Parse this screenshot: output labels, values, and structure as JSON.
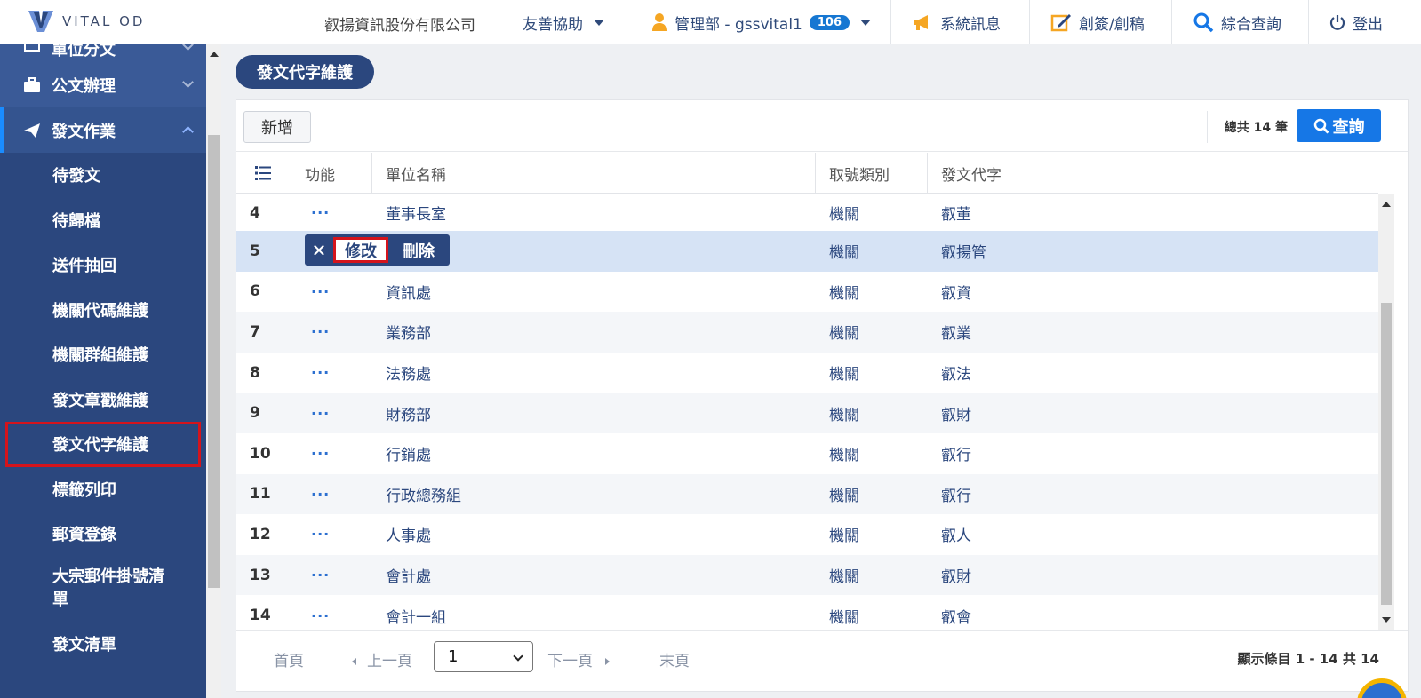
{
  "header": {
    "brand": "VITAL OD",
    "company": "叡揚資訊股份有限公司",
    "nav": {
      "help": "友善協助",
      "user": "管理部 - gssvital1",
      "user_badge": "106",
      "messages": "系統訊息",
      "create": "創簽/創稿",
      "search": "綜合查詢",
      "logout": "登出"
    }
  },
  "sidebar": {
    "groups": [
      {
        "label": "單位分文",
        "icon": "folder-icon"
      },
      {
        "label": "公文辦理",
        "icon": "briefcase-icon"
      },
      {
        "label": "發文作業",
        "icon": "paper-plane-icon"
      }
    ],
    "items": [
      {
        "label": "待發文"
      },
      {
        "label": "待歸檔"
      },
      {
        "label": "送件抽回"
      },
      {
        "label": "機關代碼維護"
      },
      {
        "label": "機關群組維護"
      },
      {
        "label": "發文章戳維護"
      },
      {
        "label": "發文代字維護"
      },
      {
        "label": "標籤列印"
      },
      {
        "label": "郵資登錄"
      },
      {
        "label": "大宗郵件掛號清單"
      },
      {
        "label": "發文清單"
      }
    ]
  },
  "page": {
    "title": "發文代字維護",
    "add_label": "新增",
    "total_label": "總共 14 筆",
    "query_label": "查詢"
  },
  "table": {
    "columns": [
      "功能",
      "單位名稱",
      "取號類別",
      "發文代字"
    ],
    "rows": [
      {
        "no": "4",
        "action": "···",
        "name": "董事長室",
        "type": "機關",
        "code": "叡董"
      },
      {
        "no": "5",
        "action": "···",
        "name": "",
        "type": "機關",
        "code": "叡揚管"
      },
      {
        "no": "6",
        "action": "···",
        "name": "資訊處",
        "type": "機關",
        "code": "叡資"
      },
      {
        "no": "7",
        "action": "···",
        "name": "業務部",
        "type": "機關",
        "code": "叡業"
      },
      {
        "no": "8",
        "action": "···",
        "name": "法務處",
        "type": "機關",
        "code": "叡法"
      },
      {
        "no": "9",
        "action": "···",
        "name": "財務部",
        "type": "機關",
        "code": "叡財"
      },
      {
        "no": "10",
        "action": "···",
        "name": "行銷處",
        "type": "機關",
        "code": "叡行"
      },
      {
        "no": "11",
        "action": "···",
        "name": "行政總務組",
        "type": "機關",
        "code": "叡行"
      },
      {
        "no": "12",
        "action": "···",
        "name": "人事處",
        "type": "機關",
        "code": "叡人"
      },
      {
        "no": "13",
        "action": "···",
        "name": "會計處",
        "type": "機關",
        "code": "叡財"
      },
      {
        "no": "14",
        "action": "···",
        "name": "會計一組",
        "type": "機關",
        "code": "叡會"
      }
    ],
    "row_menu": {
      "close": "✕",
      "edit": "修改",
      "delete": "刪除"
    }
  },
  "pager": {
    "first": "首頁",
    "prev": "上一頁",
    "page_value": "1",
    "next": "下一頁",
    "last": "末頁",
    "info": "顯示條目 1 - 14 共 14"
  },
  "colors": {
    "sidebar": "#2b477e",
    "accent": "#1677e6",
    "highlight_border": "#d4141c"
  }
}
